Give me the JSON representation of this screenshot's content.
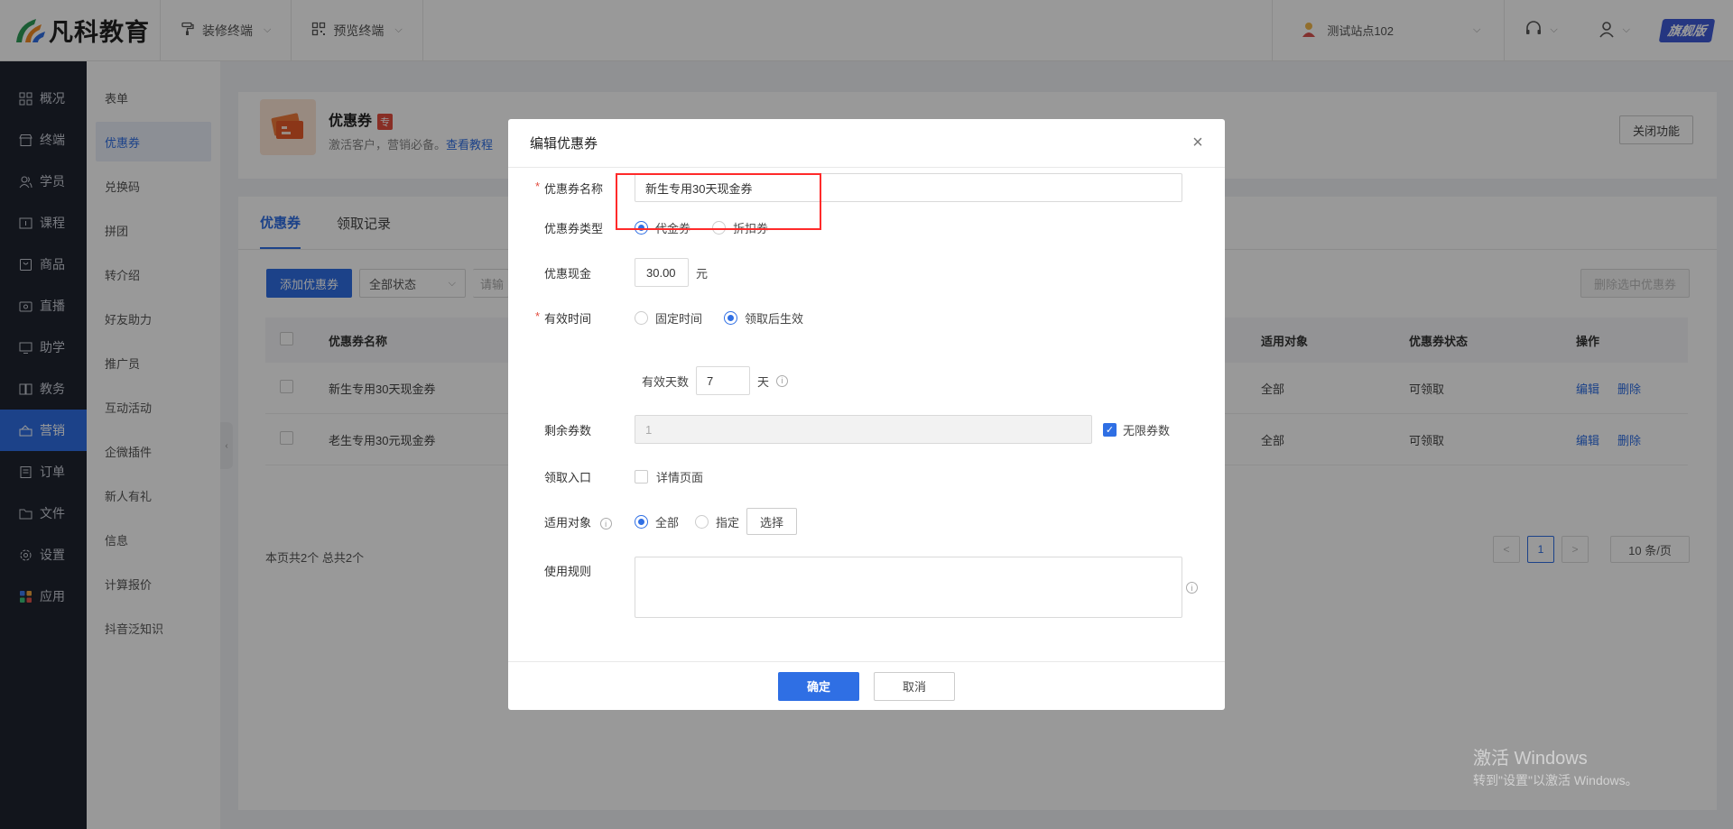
{
  "header": {
    "logo_text": "凡科教育",
    "menus": [
      {
        "label": "装修终端",
        "icon": "paint-roller-icon"
      },
      {
        "label": "预览终端",
        "icon": "qrcode-icon"
      }
    ],
    "site_name": "测试站点102",
    "vip_label": "旗舰版"
  },
  "leftnav": {
    "items": [
      {
        "label": "概况",
        "icon": "dashboard-icon",
        "active": false
      },
      {
        "label": "终端",
        "icon": "store-icon",
        "active": false
      },
      {
        "label": "学员",
        "icon": "users-icon",
        "active": false
      },
      {
        "label": "课程",
        "icon": "course-icon",
        "active": false
      },
      {
        "label": "商品",
        "icon": "goods-icon",
        "active": false
      },
      {
        "label": "直播",
        "icon": "live-icon",
        "active": false
      },
      {
        "label": "助学",
        "icon": "assist-icon",
        "active": false
      },
      {
        "label": "教务",
        "icon": "book-icon",
        "active": false
      },
      {
        "label": "营销",
        "icon": "marketing-icon",
        "active": true
      },
      {
        "label": "订单",
        "icon": "order-icon",
        "active": false
      },
      {
        "label": "文件",
        "icon": "folder-icon",
        "active": false
      },
      {
        "label": "设置",
        "icon": "gear-icon",
        "active": false
      },
      {
        "label": "应用",
        "icon": "apps-icon",
        "active": false
      }
    ]
  },
  "subnav": {
    "items": [
      {
        "label": "表单",
        "active": false
      },
      {
        "label": "优惠券",
        "active": true
      },
      {
        "label": "兑换码",
        "active": false
      },
      {
        "label": "拼团",
        "active": false
      },
      {
        "label": "转介绍",
        "active": false
      },
      {
        "label": "好友助力",
        "active": false
      },
      {
        "label": "推广员",
        "active": false
      },
      {
        "label": "互动活动",
        "active": false
      },
      {
        "label": "企微插件",
        "active": false
      },
      {
        "label": "新人有礼",
        "active": false
      },
      {
        "label": "信息",
        "active": false
      },
      {
        "label": "计算报价",
        "active": false
      },
      {
        "label": "抖音泛知识",
        "active": false
      }
    ]
  },
  "page": {
    "title": "优惠券",
    "tag": "专",
    "desc": "激活客户，营销必备。",
    "tutorial_link": "查看教程",
    "close_feature_btn": "关闭功能",
    "tabs": [
      "优惠券",
      "领取记录"
    ],
    "add_btn": "添加优惠券",
    "status_filter": "全部状态",
    "search_placeholder": "请输",
    "delete_selected_btn": "删除选中优惠券",
    "table": {
      "headers": [
        "优惠券名称",
        "适用对象",
        "优惠券状态",
        "操作"
      ],
      "rows": [
        {
          "name": "新生专用30天现金券",
          "target": "全部",
          "status": "可领取",
          "edit": "编辑",
          "delete": "删除"
        },
        {
          "name": "老生专用30元现金券",
          "target": "全部",
          "status": "可领取",
          "edit": "编辑",
          "delete": "删除"
        }
      ]
    },
    "footer_text": "本页共2个 总共2个",
    "pager": {
      "prev": "<",
      "current": "1",
      "next": ">",
      "page_size": "10 条/页"
    }
  },
  "modal": {
    "title": "编辑优惠券",
    "name_label": "优惠券名称",
    "name_value": "新生专用30天现金券",
    "type_label": "优惠券类型",
    "type_options": [
      "代金券",
      "折扣券"
    ],
    "type_selected": "代金券",
    "amount_label": "优惠现金",
    "amount_value": "30.00",
    "amount_unit": "元",
    "valid_label": "有效时间",
    "valid_options": [
      "固定时间",
      "领取后生效"
    ],
    "valid_selected": "领取后生效",
    "valid_days_label": "有效天数",
    "valid_days_value": "7",
    "valid_days_unit": "天",
    "remaining_label": "剩余券数",
    "remaining_value": "1",
    "unlimited_label": "无限券数",
    "unlimited_checked": true,
    "entry_label": "领取入口",
    "entry_option": "详情页面",
    "target_label": "适用对象",
    "target_options": [
      "全部",
      "指定"
    ],
    "target_selected": "全部",
    "choose_btn": "选择",
    "rules_label": "使用规则",
    "ok_btn": "确定",
    "cancel_btn": "取消"
  },
  "watermark": {
    "line1": "激活 Windows",
    "line2": "转到\"设置\"以激活 Windows。"
  }
}
